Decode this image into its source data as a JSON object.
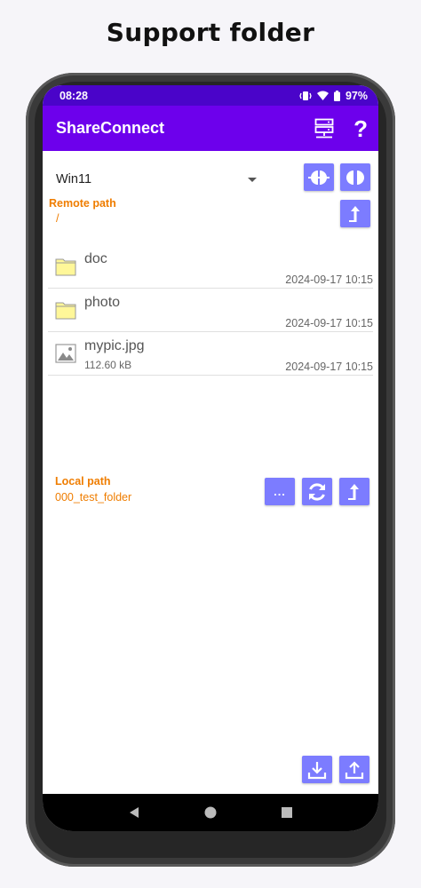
{
  "headline": "Support folder",
  "status": {
    "time": "08:28",
    "battery": "97%",
    "icons": [
      "vibrate-icon",
      "wifi-icon",
      "battery-icon"
    ]
  },
  "appbar": {
    "title": "ShareConnect",
    "help_glyph": "?",
    "server_icon": "server-icon"
  },
  "remote": {
    "server": "Win11",
    "path_label": "Remote path",
    "path_value": "/"
  },
  "files": [
    {
      "name": "doc",
      "size": "",
      "date": "2024-09-17 10:15",
      "type": "folder"
    },
    {
      "name": "photo",
      "size": "",
      "date": "2024-09-17 10:15",
      "type": "folder"
    },
    {
      "name": "mypic.jpg",
      "size": "112.60 kB",
      "date": "2024-09-17 10:15",
      "type": "image"
    }
  ],
  "local": {
    "path_label": "Local path",
    "path_value": "000_test_folder",
    "browse_label": "..."
  },
  "colors": {
    "accent": "#6d00ec",
    "statusbar": "#4a04c9",
    "button": "#7c7cff",
    "path": "#ef7d00"
  }
}
